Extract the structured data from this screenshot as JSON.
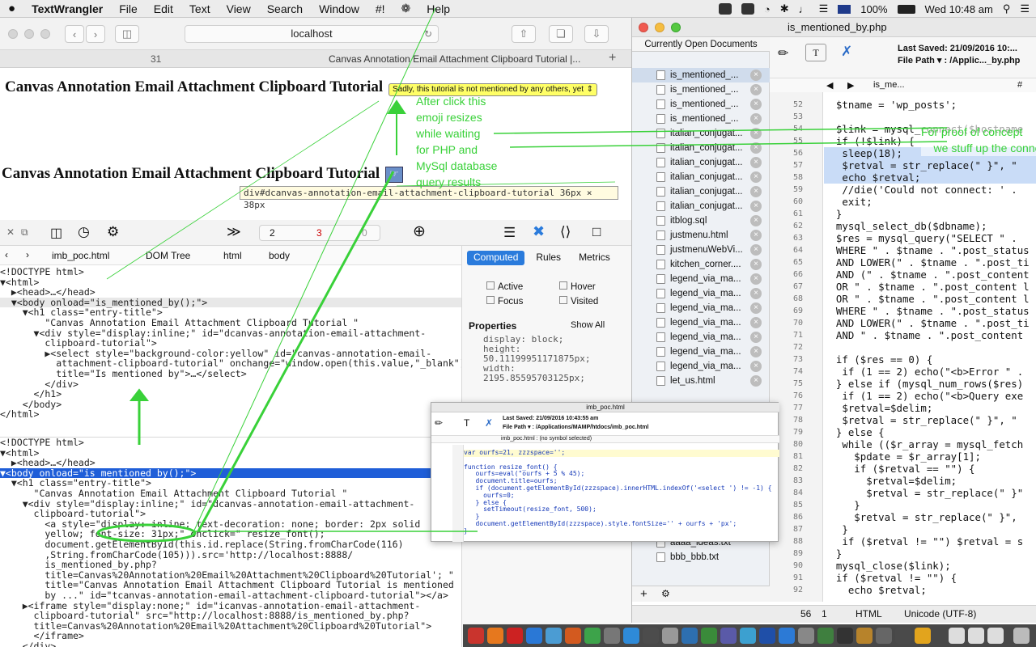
{
  "menubar": {
    "apple": "",
    "app": "TextWrangler",
    "items": [
      "File",
      "Edit",
      "Text",
      "View",
      "Search",
      "Window",
      "#!",
      "",
      "Help"
    ],
    "battery": "100%",
    "clock": "Wed 10:48 am"
  },
  "safari": {
    "url": "localhost",
    "tab_left": "31",
    "tab_right": "Canvas Annotation Email Attachment Clipboard Tutorial |...",
    "page_title": "Canvas Annotation Email Attachment Clipboard Tutorial",
    "select_text": "Sadly, this tutorial is not mentioned by any others, yet",
    "page_title2": "Canvas Annotation Email Attachment Clipboard Tutorial",
    "tooltip": "div#dcanvas-annotation-email-attachment-clipboard-tutorial 36px × 38px",
    "annotation_emoji": "After click this\nemoji resizes\nwhile waiting\nfor PHP and\nMySql database\nquery results"
  },
  "devtools": {
    "doc_count": "2",
    "errors": "3",
    "warnings": "0",
    "crumbs": [
      "imb_poc.html",
      "DOM Tree",
      "html",
      "body"
    ],
    "tabs": [
      "Computed",
      "Rules",
      "Metrics"
    ],
    "states": [
      "Active",
      "Hover",
      "Focus",
      "Visited"
    ],
    "properties_title": "Properties",
    "show_all": "Show All",
    "props": "display: block;\nheight:\n50.11199951171875px;\nwidth:\n2195.85595703125px;",
    "dom1": [
      "<!DOCTYPE html>",
      "▼<html>",
      "  ▶<head>…</head>",
      "  ▼<body onload=\"is_mentioned_by();\">",
      "    ▼<h1 class=\"entry-title\">",
      "        \"Canvas Annotation Email Attachment Clipboard Tutorial \"",
      "      ▼<div style=\"display:inline;\" id=\"dcanvas-annotation-email-attachment-",
      "        clipboard-tutorial\">",
      "        ▶<select style=\"background-color:yellow\" id=\"canvas-annotation-email-",
      "          attachment-clipboard-tutorial\" onchange=\"window.open(this.value,\"_blank\");\"",
      "          title=\"Is mentioned by\">…</select>",
      "        </div>",
      "      </h1>",
      "    </body>",
      "</html>"
    ],
    "dom2": [
      "<!DOCTYPE html>",
      "▼<html>",
      "  ▶<head>…</head>",
      "▼<body onload=\"is_mentioned_by();\">",
      "  ▼<h1 class=\"entry-title\">",
      "      \"Canvas Annotation Email Attachment Clipboard Tutorial \"",
      "    ▼<div style=\"display:inline;\" id=\"dcanvas-annotation-email-attachment-",
      "      clipboard-tutorial\">",
      "        <a style=\"display: inline; text-decoration: none; border: 2px solid",
      "        yellow; font-size: 31px;\" onclick=\" resize_font();",
      "        document.getElementById(this.id.replace(String.fromCharCode(116)",
      "        ,String.fromCharCode(105))).src='http://localhost:8888/",
      "        is_mentioned_by.php?",
      "        title=Canvas%20Annotation%20Email%20Attachment%20Clipboard%20Tutorial'; \"",
      "        title=\"Canvas Annotation Email Attachment Clipboard Tutorial is mentioned",
      "        by ...\" id=\"tcanvas-annotation-email-attachment-clipboard-tutorial\"></a>",
      "    ▶<iframe style=\"display:none;\" id=\"icanvas-annotation-email-attachment-",
      "      clipboard-tutorial\" src=\"http://localhost:8888/is_mentioned_by.php?",
      "      title=Canvas%20Annotation%20Email%20Attachment%20Clipboard%20Tutorial\">",
      "      </iframe>",
      "    </div>"
    ]
  },
  "textwrangler": {
    "filename": "is_mentioned_by.php",
    "open_docs_header": "Currently Open Documents",
    "last_saved": "Last Saved: 21/09/2016 10:...",
    "file_path": "File Path ▾ : /Applic..._by.php",
    "nav_symbol": "is_me...",
    "docs": [
      "is_mentioned_...",
      "is_mentioned_...",
      "is_mentioned_...",
      "is_mentioned_...",
      "italian_conjugat...",
      "italian_conjugat...",
      "italian_conjugat...",
      "italian_conjugat...",
      "italian_conjugat...",
      "italian_conjugat...",
      "itblog.sql",
      "justmenu.html",
      "justmenuWebVi...",
      "kitchen_corner....",
      "legend_via_ma...",
      "legend_via_ma...",
      "legend_via_ma...",
      "legend_via_ma...",
      "legend_via_ma...",
      "legend_via_ma...",
      "legend_via_ma...",
      "let_us.html"
    ],
    "docs_bottom": [
      "aaa_genmore.txt",
      "audio_1_59.htm",
      "aaaa_ideas.txt",
      "bbb_bbb.txt"
    ],
    "line_numbers": [
      "52",
      "53",
      "54",
      "55",
      "56",
      "57",
      "58",
      "59",
      "60",
      "61",
      "62",
      "63",
      "64",
      "65",
      "66",
      "67",
      "68",
      "69",
      "70",
      "71",
      "72",
      "73",
      "74",
      "75",
      "76",
      "77",
      "78",
      "79",
      "80",
      "81",
      "82",
      "83",
      "84",
      "85",
      "86",
      "87",
      "88",
      "89",
      "90",
      "91",
      "92"
    ],
    "code": [
      "  $tname = 'wp_posts';",
      "",
      "  $link = mysql_connect($hostname",
      "  if (!$link) {",
      "   sleep(18);",
      "   $retval = str_replace(\" }\", \"",
      "   echo $retval;",
      "   //die('Could not connect: ' .",
      "   exit;",
      "  }",
      "  mysql_select_db($dbname);",
      "  $res = mysql_query(\"SELECT \" .",
      "  WHERE \" . $tname . \".post_status",
      "  AND LOWER(\" . $tname . \".post_ti",
      "  AND (\" . $tname . \".post_content",
      "  OR \" . $tname . \".post_content l",
      "  OR \" . $tname . \".post_content l",
      "  WHERE \" . $tname . \".post_status",
      "  AND LOWER(\" . $tname . \".post_ti",
      "  AND \" . $tname . \".post_content",
      "",
      "  if ($res == 0) {",
      "   if (1 == 2) echo(\"<b>Error \" .",
      "  } else if (mysql_num_rows($res)",
      "   if (1 == 2) echo(\"<b>Query exe",
      "   $retval=$delim;",
      "   $retval = str_replace(\" }\", \"",
      "  } else {",
      "   while (($r_array = mysql_fetch",
      "     $pdate = $r_array[1];",
      "     if ($retval == \"\") {",
      "       $retval=$delim;",
      "       $retval = str_replace(\" }\"",
      "     }",
      "     $retval = str_replace(\" }\",",
      "   }",
      "   if ($retval != \"\") $retval = s",
      "  }",
      "  mysql_close($link);",
      "  if ($retval != \"\") {",
      "    echo $retval;"
    ],
    "annotation_proof": "For proof of concept\n    we stuff up the conne",
    "status_line": "56",
    "status_col": "1",
    "status_lang": "HTML",
    "status_enc": "Unicode (UTF-8)"
  },
  "mini_window": {
    "title": "imb_poc.html",
    "last_saved": "Last Saved: 21/09/2016 10:43:55 am",
    "file_path": "File Path ▾ : /Applications/MAMP/htdocs/imb_poc.html",
    "nav": "imb_poc.html   :   (no symbol selected)",
    "code": [
      "var ourfs=21, zzzspace='';",
      "",
      "function resize_font() {",
      "   ourfs=eval(\"ourfs + 5 % 45);",
      "   document.title=ourfs;",
      "   if (document.getElementById(zzzspace).innerHTML.indexOf('<select ') != -1) {",
      "     ourfs=0;",
      "   } else {",
      "     setTimeout(resize_font, 500);",
      "   }",
      "   document.getElementById(zzzspace).style.fontSize='' + ourfs + 'px';",
      "}"
    ]
  }
}
